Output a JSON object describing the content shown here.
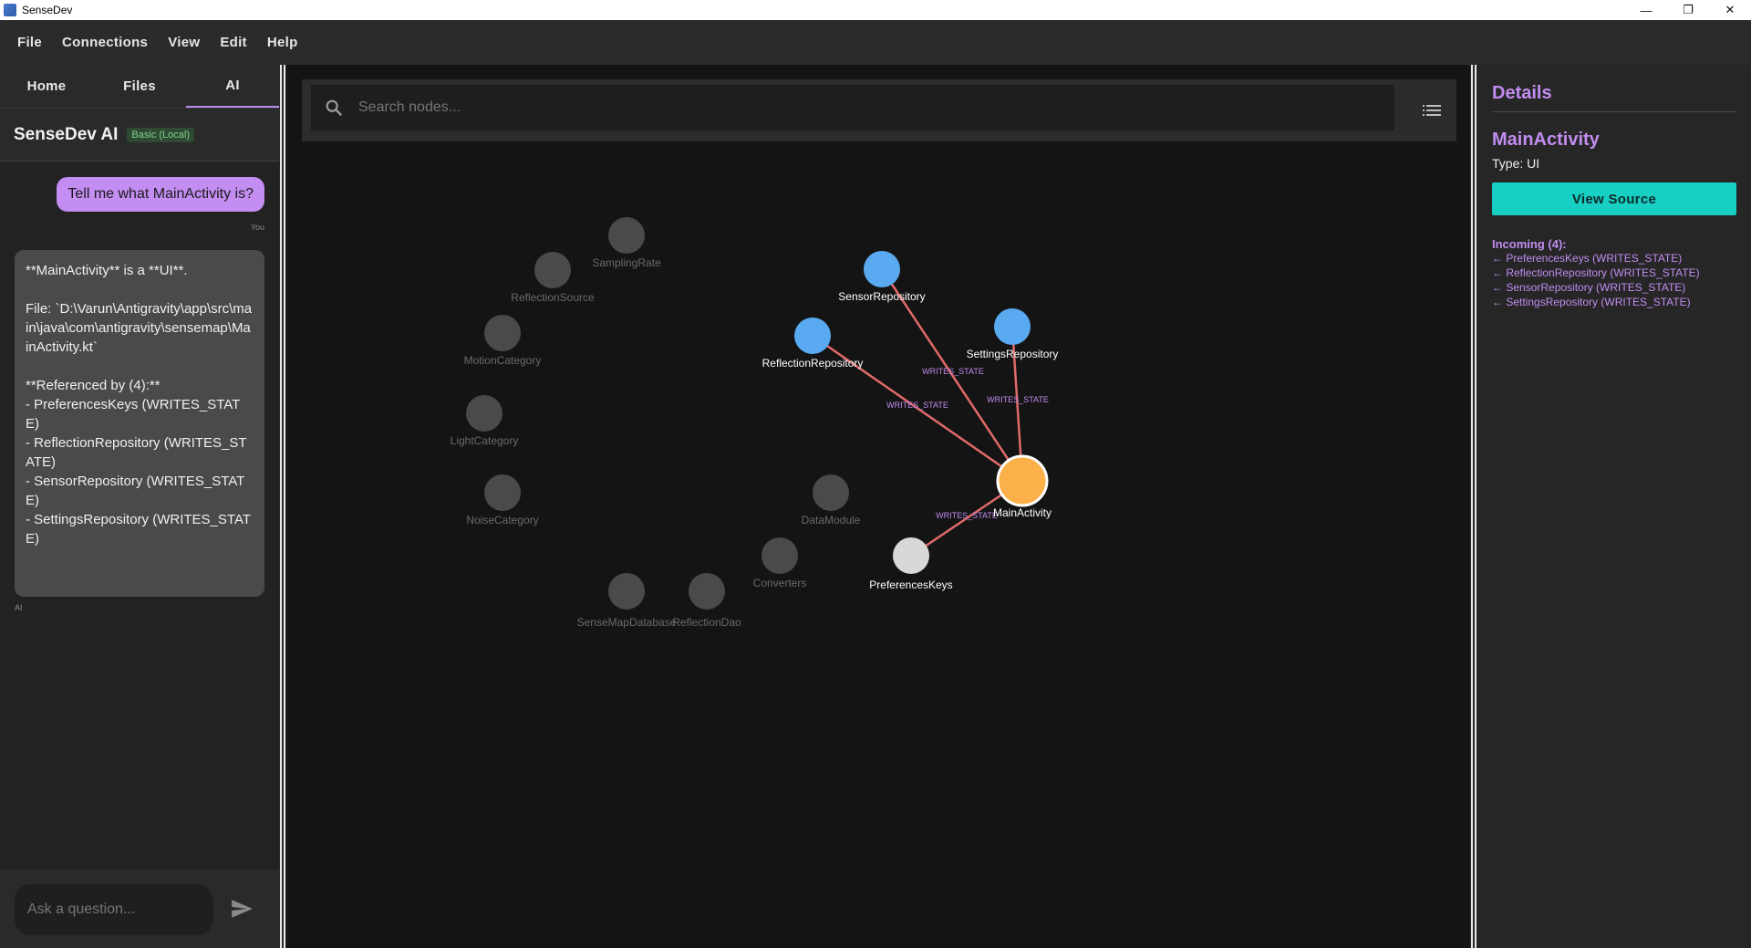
{
  "window": {
    "title": "SenseDev",
    "min_glyph": "—",
    "restore_glyph": "❐",
    "close_glyph": "✕"
  },
  "menu": [
    "File",
    "Connections",
    "View",
    "Edit",
    "Help"
  ],
  "left": {
    "tabs": [
      {
        "label": "Home"
      },
      {
        "label": "Files"
      },
      {
        "label": "AI",
        "active": true
      }
    ],
    "ai_title": "SenseDev AI",
    "ai_badge": "Basic (Local)",
    "user_message": "Tell me what MainActivity is?",
    "user_tag": "You",
    "ai_message": "**MainActivity** is a **UI**.\n\nFile: `D:\\Varun\\Antigravity\\app\\src\\main\\java\\com\\antigravity\\sensemap\\MainActivity.kt`\n\n**Referenced by (4):**\n- PreferencesKeys (WRITES_STATE)\n- ReflectionRepository (WRITES_STATE)\n- SensorRepository (WRITES_STATE)\n- SettingsRepository (WRITES_STATE)",
    "ai_tag": "AI",
    "input_placeholder": "Ask a question..."
  },
  "graph": {
    "search_placeholder": "Search nodes...",
    "colors": {
      "dim_node": "#4a4a4a",
      "dim_label": "#6a6a6a",
      "repo": "#5aaaf2",
      "focus": "#fbb04a",
      "prefs": "#d8d8d8",
      "edge": "#e06a6a",
      "edge_label": "#c18df0"
    },
    "nodes": [
      {
        "id": "SamplingRate",
        "label": "SamplingRate",
        "kind": "dim"
      },
      {
        "id": "ReflectionSource",
        "label": "ReflectionSource",
        "kind": "dim"
      },
      {
        "id": "MotionCategory",
        "label": "MotionCategory",
        "kind": "dim"
      },
      {
        "id": "LightCategory",
        "label": "LightCategory",
        "kind": "dim"
      },
      {
        "id": "NoiseCategory",
        "label": "NoiseCategory",
        "kind": "dim"
      },
      {
        "id": "DataModule",
        "label": "DataModule",
        "kind": "dim"
      },
      {
        "id": "Converters",
        "label": "Converters",
        "kind": "dim"
      },
      {
        "id": "SenseMapDatabase",
        "label": "SenseMapDatabase",
        "kind": "dim"
      },
      {
        "id": "ReflectionDao",
        "label": "ReflectionDao",
        "kind": "dim"
      },
      {
        "id": "SensorRepository",
        "label": "SensorRepository",
        "kind": "repo"
      },
      {
        "id": "ReflectionRepository",
        "label": "ReflectionRepository",
        "kind": "repo"
      },
      {
        "id": "SettingsRepository",
        "label": "SettingsRepository",
        "kind": "repo"
      },
      {
        "id": "MainActivity",
        "label": "MainActivity",
        "kind": "focus"
      },
      {
        "id": "PreferencesKeys",
        "label": "PreferencesKeys",
        "kind": "prefs"
      }
    ],
    "edges": [
      {
        "from": "SensorRepository",
        "to": "MainActivity",
        "label": "WRITES_STATE"
      },
      {
        "from": "ReflectionRepository",
        "to": "MainActivity",
        "label": "WRITES_STATE"
      },
      {
        "from": "SettingsRepository",
        "to": "MainActivity",
        "label": "WRITES_STATE"
      },
      {
        "from": "PreferencesKeys",
        "to": "MainActivity",
        "label": "WRITES_STATE"
      }
    ]
  },
  "details": {
    "heading": "Details",
    "node_name": "MainActivity",
    "node_type": "Type: UI",
    "view_source_label": "View Source",
    "incoming_title": "Incoming (4):",
    "incoming": [
      "← PreferencesKeys (WRITES_STATE)",
      "← ReflectionRepository (WRITES_STATE)",
      "← SensorRepository (WRITES_STATE)",
      "← SettingsRepository (WRITES_STATE)"
    ]
  }
}
